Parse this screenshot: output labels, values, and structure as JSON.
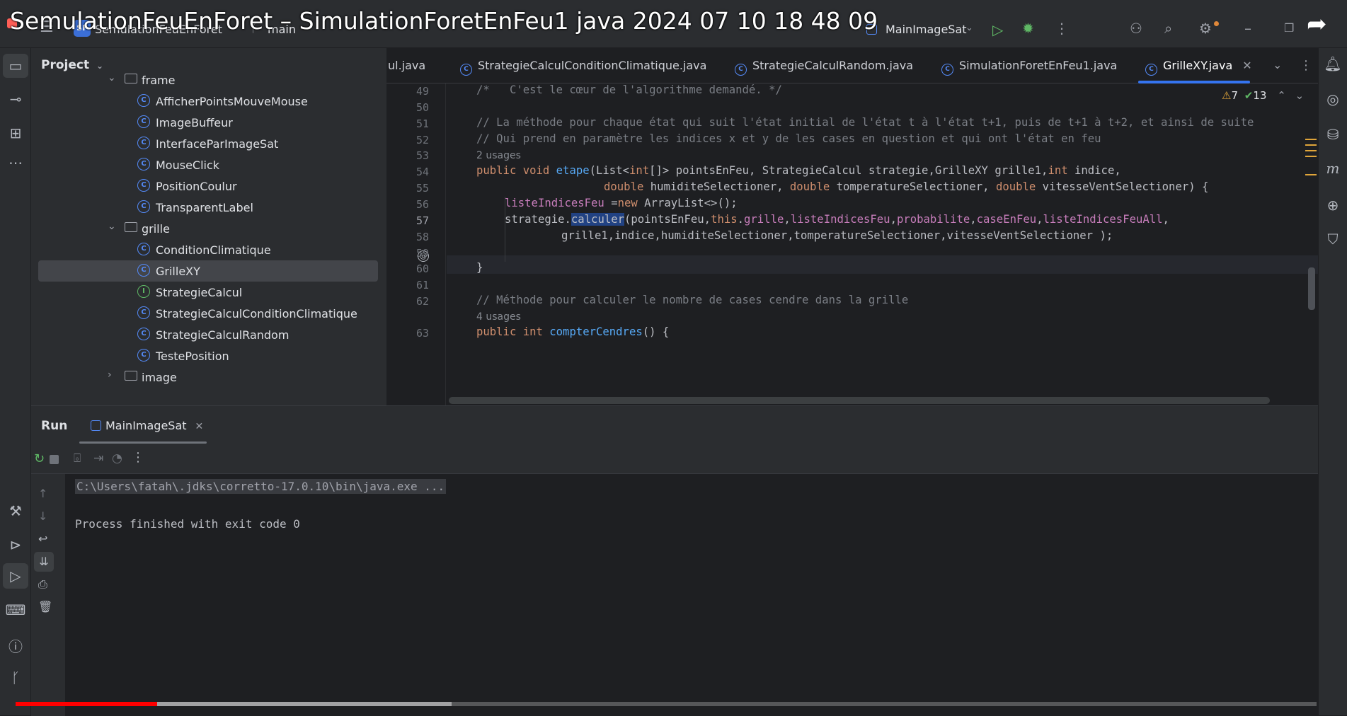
{
  "overlay_title": "SemulationFeuEnForet – SimulationForetEnFeu1 java 2024 07 10 18 48 09",
  "titlebar": {
    "project_badge": "SF",
    "project_name": "SemulationFeuEnForet",
    "branch": "main",
    "run_config": "MainImageSat"
  },
  "project_panel": {
    "title": "Project",
    "tree": [
      {
        "label": "frame",
        "type": "folder",
        "expanded": true,
        "depth": 1
      },
      {
        "label": "AfficherPointsMouveMouse",
        "type": "class",
        "depth": 2
      },
      {
        "label": "ImageBuffeur",
        "type": "class",
        "depth": 2
      },
      {
        "label": "InterfaceParImageSat",
        "type": "class",
        "depth": 2
      },
      {
        "label": "MouseClick",
        "type": "class",
        "depth": 2
      },
      {
        "label": "PositionCoulur",
        "type": "class",
        "depth": 2
      },
      {
        "label": "TransparentLabel",
        "type": "class",
        "depth": 2
      },
      {
        "label": "grille",
        "type": "folder",
        "expanded": true,
        "depth": 1
      },
      {
        "label": "ConditionClimatique",
        "type": "class",
        "depth": 2
      },
      {
        "label": "GrilleXY",
        "type": "class",
        "depth": 2,
        "selected": true
      },
      {
        "label": "StrategieCalcul",
        "type": "interface",
        "depth": 2
      },
      {
        "label": "StrategieCalculConditionClimatique",
        "type": "class",
        "depth": 2
      },
      {
        "label": "StrategieCalculRandom",
        "type": "class",
        "depth": 2
      },
      {
        "label": "TestePosition",
        "type": "class",
        "depth": 2
      },
      {
        "label": "image",
        "type": "folder",
        "expanded": false,
        "depth": 1
      }
    ]
  },
  "editor": {
    "tabs": [
      {
        "label": "ul.java",
        "active": false
      },
      {
        "label": "StrategieCalculConditionClimatique.java",
        "active": false
      },
      {
        "label": "StrategieCalculRandom.java",
        "active": false
      },
      {
        "label": "SimulationForetEnFeu1.java",
        "active": false
      },
      {
        "label": "GrilleXY.java",
        "active": true
      }
    ],
    "inspections": {
      "warnings": "7",
      "ok": "13"
    },
    "line_numbers": [
      "49",
      "50",
      "51",
      "52",
      "53",
      "54",
      "55",
      "56",
      "57",
      "58",
      "59",
      "60",
      "61",
      "62",
      "63"
    ],
    "current_line": "57",
    "usages_54": "2 usages",
    "usages_63": "4 usages",
    "code": {
      "l49": "/*   C'est le cœur de l'algorithme demandé. */",
      "l51": "// La méthode pour chaque état qui suit l'état initial de l'état t à l'état t+1, puis de t+1 à t+2, et ainsi de suite",
      "l52": "// Qui prend en paramètre les indices x et y de les cases en question et qui ont l'état en feu",
      "l54_kw": "public void ",
      "l54_fn": "etape",
      "l54_a": "(List<",
      "l54_kw2": "int",
      "l54_b": "[]> pointsEnFeu, StrategieCalcul strategie,GrilleXY grille1,",
      "l54_kw3": "int",
      "l54_c": " indice,",
      "l55_kw": "double",
      "l55_a": " humiditeSelectioner, ",
      "l55_kw2": "double",
      "l55_b": " tomperatureSelectioner, ",
      "l55_kw3": "double",
      "l55_c": " vitesseVentSelectioner) {",
      "l56_fld": "listeIndicesFeu",
      "l56_a": " =",
      "l56_kw": "new",
      "l56_b": " ArrayList<>();",
      "l57_a": "strategie.",
      "l57_sel": "calculer",
      "l57_b": "(pointsEnFeu,",
      "l57_kw": "this",
      "l57_c": ".",
      "l57_f1": "grille",
      "l57_d": ",",
      "l57_f2": "listeIndicesFeu",
      "l57_e": ",",
      "l57_f3": "probabilite",
      "l57_f": ",",
      "l57_f4": "caseEnFeu",
      "l57_g": ",",
      "l57_f5": "listeIndicesFeuAll",
      "l57_h": ",",
      "l58": "grille1,indice,humiditeSelectioner,tomperatureSelectioner,vitesseVentSelectioner );",
      "l60": "}",
      "l62": "// Méthode pour calculer le nombre de cases cendre dans la grille",
      "l63_kw": "public int ",
      "l63_fn": "compterCendres",
      "l63_a": "() {"
    }
  },
  "run_panel": {
    "title": "Run",
    "tab": "MainImageSat",
    "console": {
      "command": "C:\\Users\\fatah\\.jdks\\corretto-17.0.10\\bin\\java.exe ...",
      "exit": "Process finished with exit code 0"
    }
  },
  "video": {
    "progress": 0.109,
    "buffered": 0.335
  },
  "colors": {
    "accent": "#3574f0",
    "keyword": "#cf8e6d",
    "function": "#57aaf7",
    "field": "#c77dbb",
    "progress": "#ff0000"
  }
}
